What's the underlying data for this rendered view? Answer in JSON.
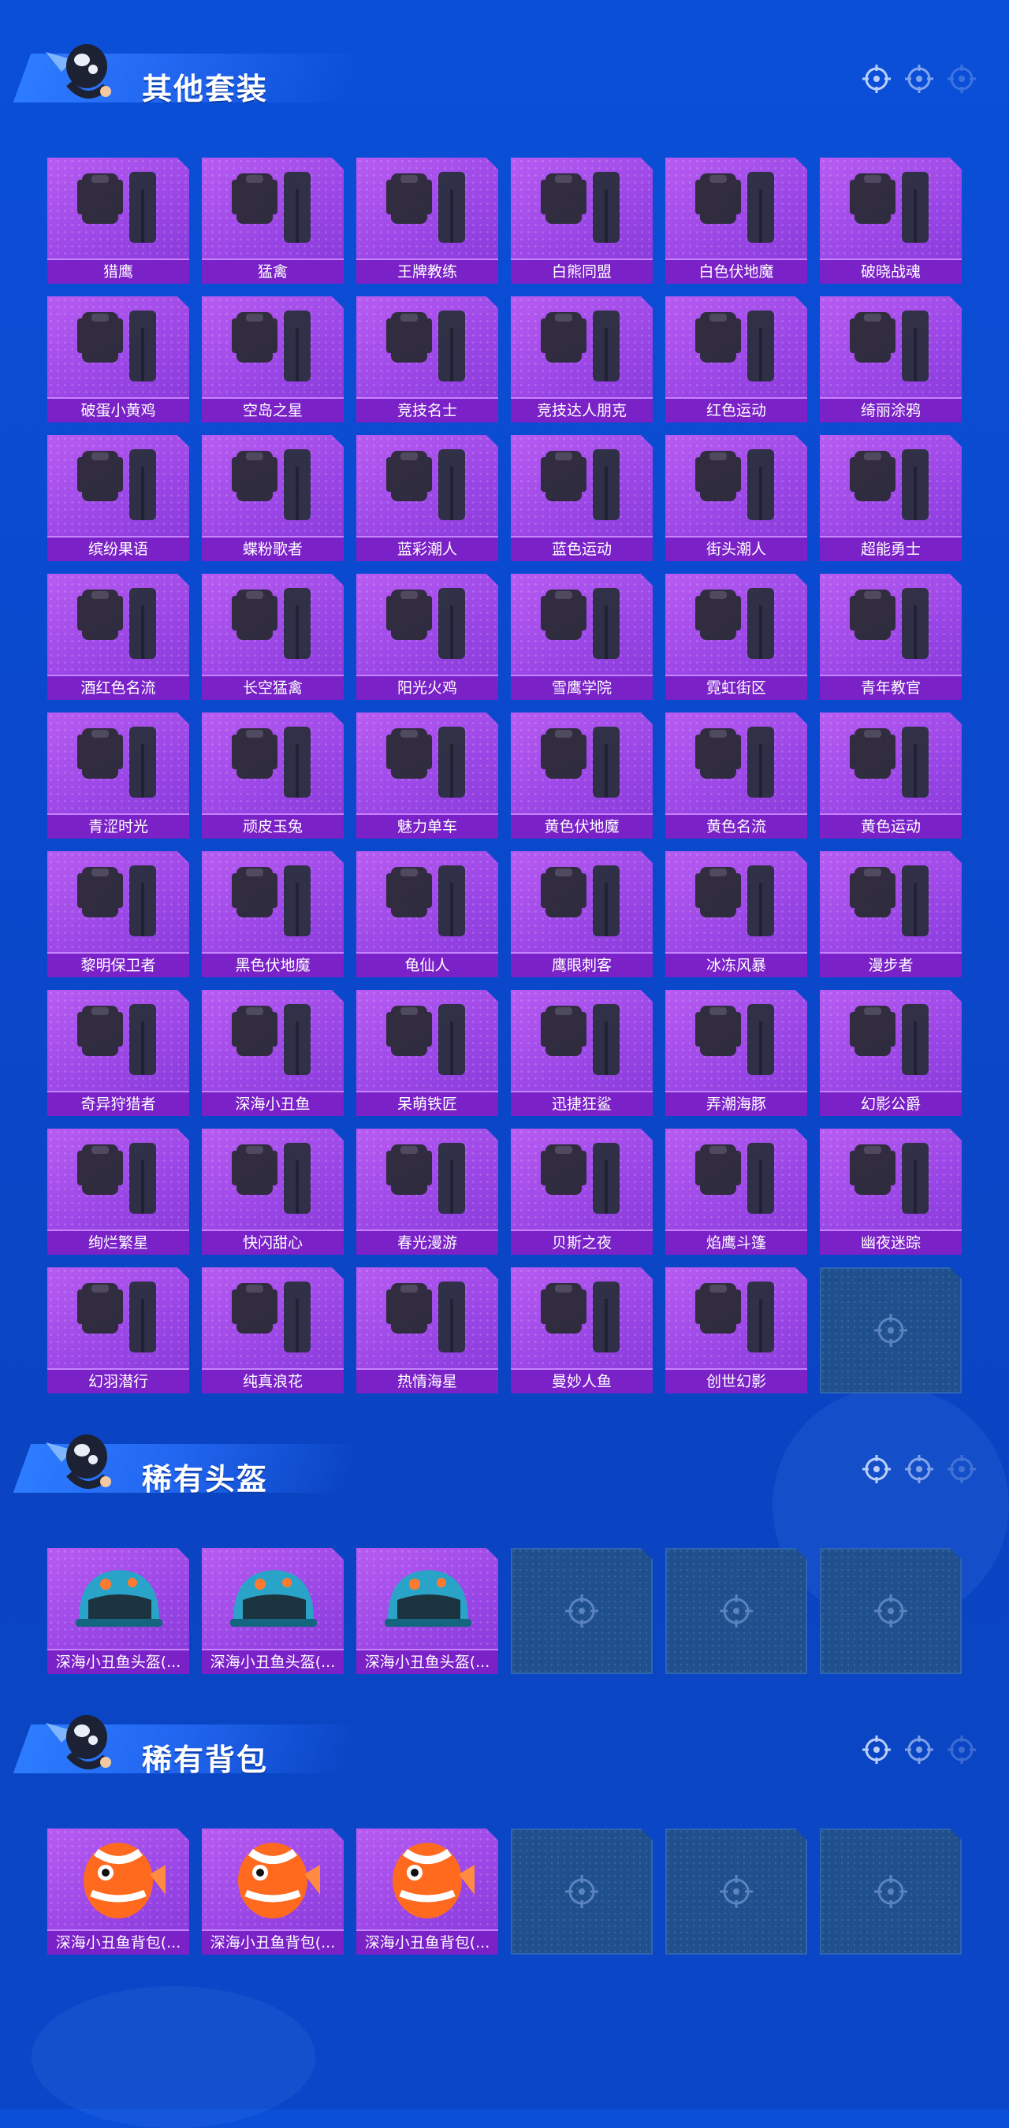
{
  "sections": {
    "outfits": {
      "title": "其他套装",
      "items": [
        "猎鹰",
        "猛禽",
        "王牌教练",
        "白熊同盟",
        "白色伏地魔",
        "破晓战魂",
        "破蛋小黄鸡",
        "空岛之星",
        "竞技名士",
        "竞技达人朋克",
        "红色运动",
        "绮丽涂鸦",
        "缤纷果语",
        "蝶粉歌者",
        "蓝彩潮人",
        "蓝色运动",
        "街头潮人",
        "超能勇士",
        "酒红色名流",
        "长空猛禽",
        "阳光火鸡",
        "雪鹰学院",
        "霓虹街区",
        "青年教官",
        "青涩时光",
        "顽皮玉兔",
        "魅力单车",
        "黄色伏地魔",
        "黄色名流",
        "黄色运动",
        "黎明保卫者",
        "黑色伏地魔",
        "龟仙人",
        "鹰眼刺客",
        "冰冻风暴",
        "漫步者",
        "奇异狩猎者",
        "深海小丑鱼",
        "呆萌铁匠",
        "迅捷狂鲨",
        "弄潮海豚",
        "幻影公爵",
        "绚烂繁星",
        "快闪甜心",
        "春光漫游",
        "贝斯之夜",
        "焰鹰斗篷",
        "幽夜迷踪",
        "幻羽潜行",
        "纯真浪花",
        "热情海星",
        "曼妙人鱼",
        "创世幻影"
      ]
    },
    "helmets": {
      "title": "稀有头盔",
      "items": [
        "深海小丑鱼头盔(...",
        "深海小丑鱼头盔(...",
        "深海小丑鱼头盔(..."
      ]
    },
    "backpacks": {
      "title": "稀有背包",
      "items": [
        "深海小丑鱼背包(...",
        "深海小丑鱼背包(...",
        "深海小丑鱼背包(..."
      ]
    }
  },
  "icons": {
    "empty_slot": "crosshair-icon",
    "header_marker": "crosshair-icon",
    "mascot": "mascot-icon"
  },
  "colors": {
    "background": "#0b4fd8",
    "card": "#a04de8",
    "card_label": "#7a21c8",
    "empty_slot": "#1f4f8c"
  }
}
